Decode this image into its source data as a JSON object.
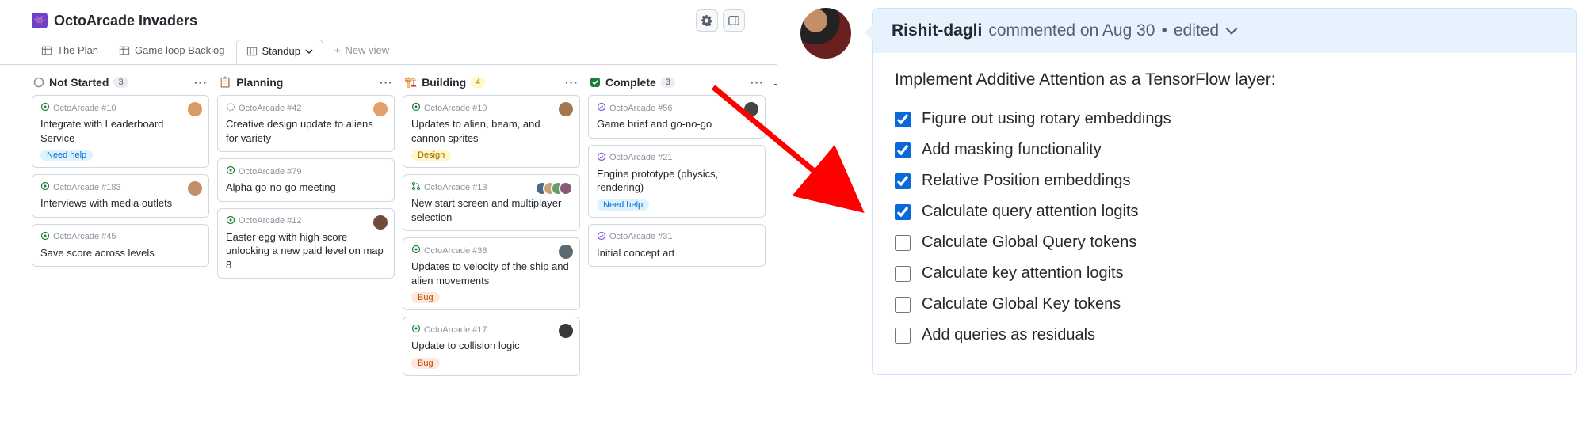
{
  "board": {
    "logo_glyph": "👾",
    "title": "OctoArcade Invaders",
    "tabs": [
      {
        "label": "The Plan",
        "active": false
      },
      {
        "label": "Game loop Backlog",
        "active": false
      },
      {
        "label": "Standup",
        "active": true
      },
      {
        "label": "New view",
        "active": false,
        "is_new": true
      }
    ],
    "columns": [
      {
        "name": "Not Started",
        "status_color": "#8c959f",
        "count": "3",
        "cards": [
          {
            "repo": "OctoArcade #10",
            "icon": "issue-open",
            "title": "Integrate with Leaderboard Service",
            "labels": [
              "Need help"
            ],
            "avatar": "#d99b63"
          },
          {
            "repo": "OctoArcade #183",
            "icon": "issue-open",
            "title": "Interviews with media outlets",
            "avatar": "#c38e69"
          },
          {
            "repo": "OctoArcade #45",
            "icon": "issue-open",
            "title": "Save score across levels"
          }
        ]
      },
      {
        "name": "Planning",
        "status_icon": "📋",
        "count": "",
        "cards": [
          {
            "repo": "OctoArcade #42",
            "icon": "draft",
            "title": "Creative design update to aliens for variety",
            "avatar": "#e2a16a"
          },
          {
            "repo": "OctoArcade #79",
            "icon": "issue-open",
            "title": "Alpha go-no-go meeting"
          },
          {
            "repo": "OctoArcade #12",
            "icon": "issue-open",
            "title": "Easter egg with high score unlocking a new paid level on map 8",
            "avatar": "#704b39"
          }
        ]
      },
      {
        "name": "Building",
        "status_icon": "🏗️",
        "count": "4",
        "count_bg": "#fff8c5",
        "cards": [
          {
            "repo": "OctoArcade #19",
            "icon": "issue-open",
            "title": "Updates to alien, beam, and cannon sprites",
            "labels_design": [
              "Design"
            ],
            "avatar": "#a3784f"
          },
          {
            "repo": "OctoArcade #13",
            "icon": "pr-open",
            "title": "New start screen and multiplayer selection",
            "avatars": [
              "#4a6b8a",
              "#caa27a",
              "#6b9a6b",
              "#8a5a7a"
            ]
          },
          {
            "repo": "OctoArcade #38",
            "icon": "issue-open",
            "title": "Updates to velocity of the ship and alien movements",
            "labels_bug": [
              "Bug"
            ],
            "avatar": "#5a6b72"
          },
          {
            "repo": "OctoArcade #17",
            "icon": "issue-open",
            "title": "Update to collision logic",
            "labels_bug": [
              "Bug"
            ],
            "avatar": "#3a3a3a"
          }
        ]
      },
      {
        "name": "Complete",
        "status_check": true,
        "count": "3",
        "cards": [
          {
            "repo": "OctoArcade #56",
            "icon": "issue-closed",
            "title": "Game brief and go-no-go",
            "avatar": "#444"
          },
          {
            "repo": "OctoArcade #21",
            "icon": "issue-closed",
            "title": "Engine prototype (physics, rendering)",
            "labels": [
              "Need help"
            ]
          },
          {
            "repo": "OctoArcade #31",
            "icon": "issue-closed",
            "title": "Initial concept art"
          }
        ]
      }
    ]
  },
  "comment": {
    "username": "Rishit-dagli",
    "action_text": "commented on Aug 30",
    "edited_text": "edited",
    "body_title": "Implement Additive Attention as a TensorFlow layer:",
    "tasks": [
      {
        "done": true,
        "text": "Figure out using rotary embeddings"
      },
      {
        "done": true,
        "text": "Add masking functionality"
      },
      {
        "done": true,
        "text": "Relative Position embeddings"
      },
      {
        "done": true,
        "text": "Calculate query attention logits"
      },
      {
        "done": false,
        "text": "Calculate Global Query tokens"
      },
      {
        "done": false,
        "text": "Calculate key attention logits"
      },
      {
        "done": false,
        "text": "Calculate Global Key tokens"
      },
      {
        "done": false,
        "text": "Add queries as residuals"
      }
    ]
  }
}
